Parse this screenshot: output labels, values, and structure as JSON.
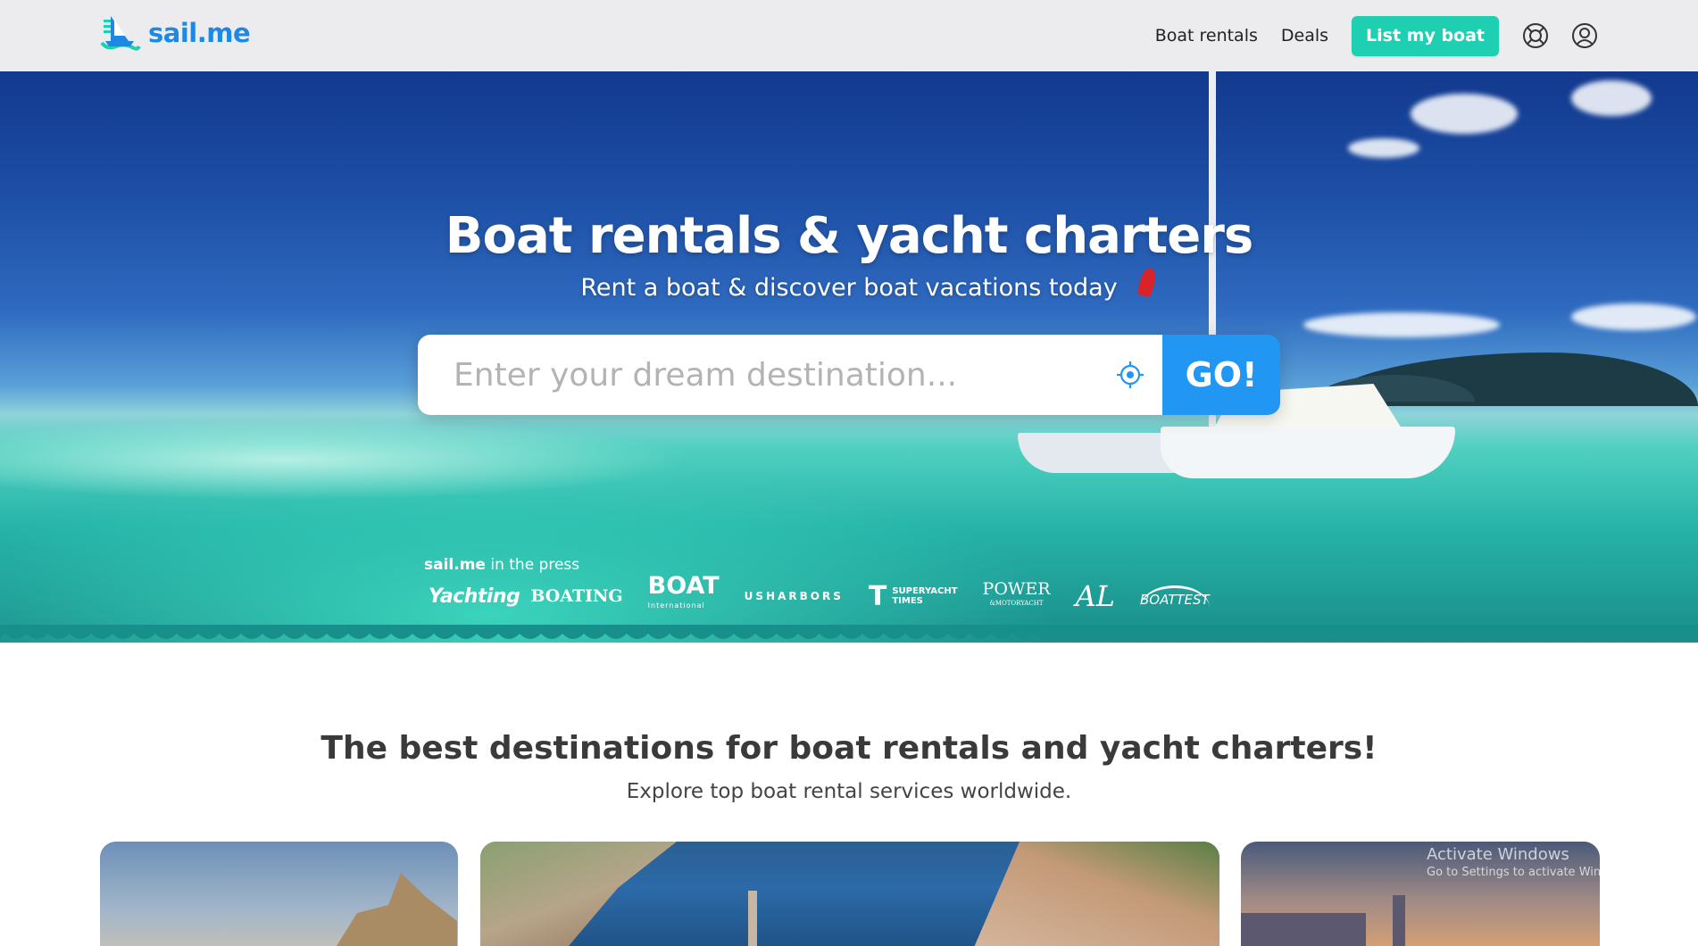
{
  "brand": {
    "name": "sail.me",
    "logo_icon": "sailboat-logo-icon"
  },
  "nav": {
    "items": [
      {
        "label": "Boat rentals"
      },
      {
        "label": "Deals"
      }
    ],
    "cta_label": "List my boat",
    "icons": [
      "help-lifebuoy-icon",
      "user-account-icon"
    ]
  },
  "hero": {
    "title": "Boat rentals & yacht charters",
    "subtitle": "Rent a boat & discover boat vacations today",
    "search": {
      "placeholder": "Enter your dream destination...",
      "value": "",
      "locate_icon": "crosshair-locate-icon",
      "button_label": "GO!"
    },
    "press": {
      "brand": "sail.me",
      "label": " in the press",
      "logos": {
        "yachting": "Yachting",
        "boating": "BOATING",
        "boat": "BOAT",
        "boat_sub": "International",
        "usharbors": "USHARBORS",
        "superyacht_mark": "T",
        "superyacht": "SUPERYACHT",
        "superyacht_sub": "TIMES",
        "power": "POWER",
        "power_sub": "&MOTORYACHT",
        "al": "AL",
        "boattest": "BOATTEST"
      }
    }
  },
  "destinations": {
    "title": "The best destinations for boat rentals and yacht charters!",
    "subtitle": "Explore top boat rental services worldwide."
  },
  "watermark": {
    "line1": "Activate Windows",
    "line2": "Go to Settings to activate Windows."
  },
  "colors": {
    "brand_blue": "#1e88e5",
    "cta_teal": "#1fcfb2",
    "go_blue": "#2196f3",
    "header_bg": "#ececef"
  }
}
